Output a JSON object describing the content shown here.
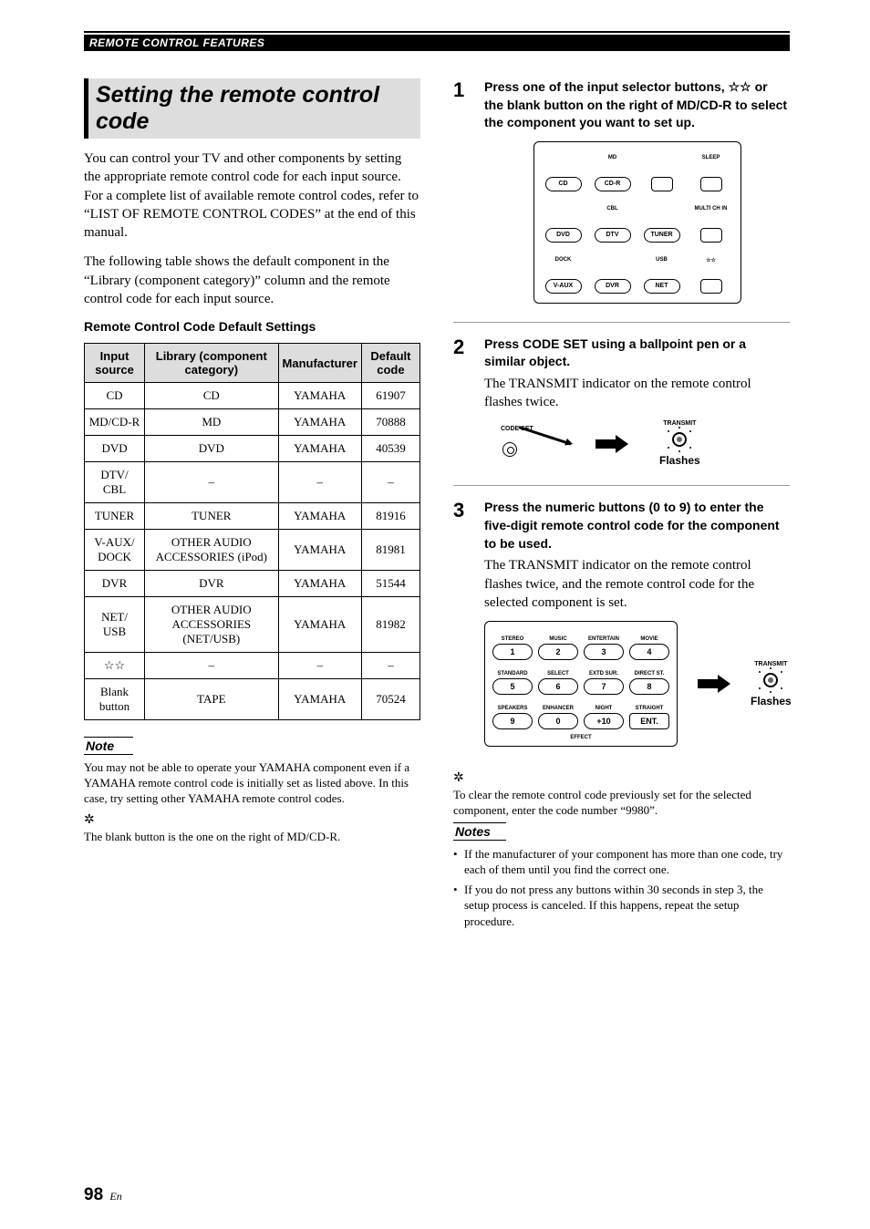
{
  "header": {
    "section": "REMOTE CONTROL FEATURES"
  },
  "left": {
    "title": "Setting the remote control code",
    "p1": "You can control your TV and other components by setting the appropriate remote control code for each input source. For a complete list of available remote control codes, refer to “LIST OF REMOTE CONTROL CODES” at the end of this manual.",
    "p2": "The following table shows the default component in the “Library (component category)” column and the remote control code for each input source.",
    "tableCaption": "Remote Control Code Default Settings",
    "headers": [
      "Input source",
      "Library (component category)",
      "Manufacturer",
      "Default code"
    ],
    "rows": [
      [
        "CD",
        "CD",
        "YAMAHA",
        "61907"
      ],
      [
        "MD/CD-R",
        "MD",
        "YAMAHA",
        "70888"
      ],
      [
        "DVD",
        "DVD",
        "YAMAHA",
        "40539"
      ],
      [
        "DTV/\nCBL",
        "–",
        "–",
        "–"
      ],
      [
        "TUNER",
        "TUNER",
        "YAMAHA",
        "81916"
      ],
      [
        "V-AUX/\nDOCK",
        "OTHER AUDIO ACCESSORIES (iPod)",
        "YAMAHA",
        "81981"
      ],
      [
        "DVR",
        "DVR",
        "YAMAHA",
        "51544"
      ],
      [
        "NET/\nUSB",
        "OTHER AUDIO ACCESSORIES (NET/USB)",
        "YAMAHA",
        "81982"
      ],
      [
        "☆☆",
        "–",
        "–",
        "–"
      ],
      [
        "Blank button",
        "TAPE",
        "YAMAHA",
        "70524"
      ]
    ],
    "noteLabel": "Note",
    "noteText": "You may not be able to operate your YAMAHA component even if a YAMAHA remote control code is initially set as listed above. In this case, try setting other YAMAHA remote control codes.",
    "tipText": "The blank button is the one on the right of MD/CD-R."
  },
  "right": {
    "steps": [
      {
        "num": "1",
        "instruction": "Press one of the input selector buttons, ☆☆ or the blank button on the right of MD/CD-R to select the component you want to set up.",
        "desc": "",
        "remote": {
          "row1": [
            "",
            "MD",
            "",
            "SLEEP"
          ],
          "row1btn": [
            "CD",
            "CD-R",
            "",
            ""
          ],
          "row2": [
            "",
            "CBL",
            "",
            "MULTI CH IN"
          ],
          "row2btn": [
            "DVD",
            "DTV",
            "TUNER",
            ""
          ],
          "row3": [
            "DOCK",
            "",
            "USB",
            "☆☆"
          ],
          "row3btn": [
            "V-AUX",
            "DVR",
            "NET",
            ""
          ]
        }
      },
      {
        "num": "2",
        "instruction": "Press CODE SET using a ballpoint pen or a similar object.",
        "desc": "The TRANSMIT indicator on the remote control flashes twice.",
        "codeSetLabel": "CODE SET",
        "transmitLabel": "TRANSMIT",
        "flashes": "Flashes"
      },
      {
        "num": "3",
        "instruction": "Press the numeric buttons (0 to 9) to enter the five-digit remote control code for the component to be used.",
        "desc": "The TRANSMIT indicator on the remote control flashes twice, and the remote control code for the selected component is set.",
        "keypadLabels": [
          "STEREO",
          "MUSIC",
          "ENTERTAIN",
          "MOVIE",
          "STANDARD",
          "SELECT",
          "EXTD SUR.",
          "DIRECT ST.",
          "SPEAKERS",
          "ENHANCER",
          "NIGHT",
          "STRAIGHT"
        ],
        "keypadBtns": [
          "1",
          "2",
          "3",
          "4",
          "5",
          "6",
          "7",
          "8",
          "9",
          "0",
          "+10",
          "ENT."
        ],
        "effect": "EFFECT",
        "transmitLabel": "TRANSMIT",
        "flashes": "Flashes"
      }
    ],
    "bottomTip": "To clear the remote control code previously set for the selected component, enter the code number “9980”.",
    "notesLabel": "Notes",
    "notes": [
      "If the manufacturer of your component has more than one code, try each of them until you find the correct one.",
      "If you do not press any buttons within 30 seconds in step 3, the setup process is canceled. If this happens, repeat the setup procedure."
    ]
  },
  "pageNumber": "98",
  "pageLang": "En"
}
